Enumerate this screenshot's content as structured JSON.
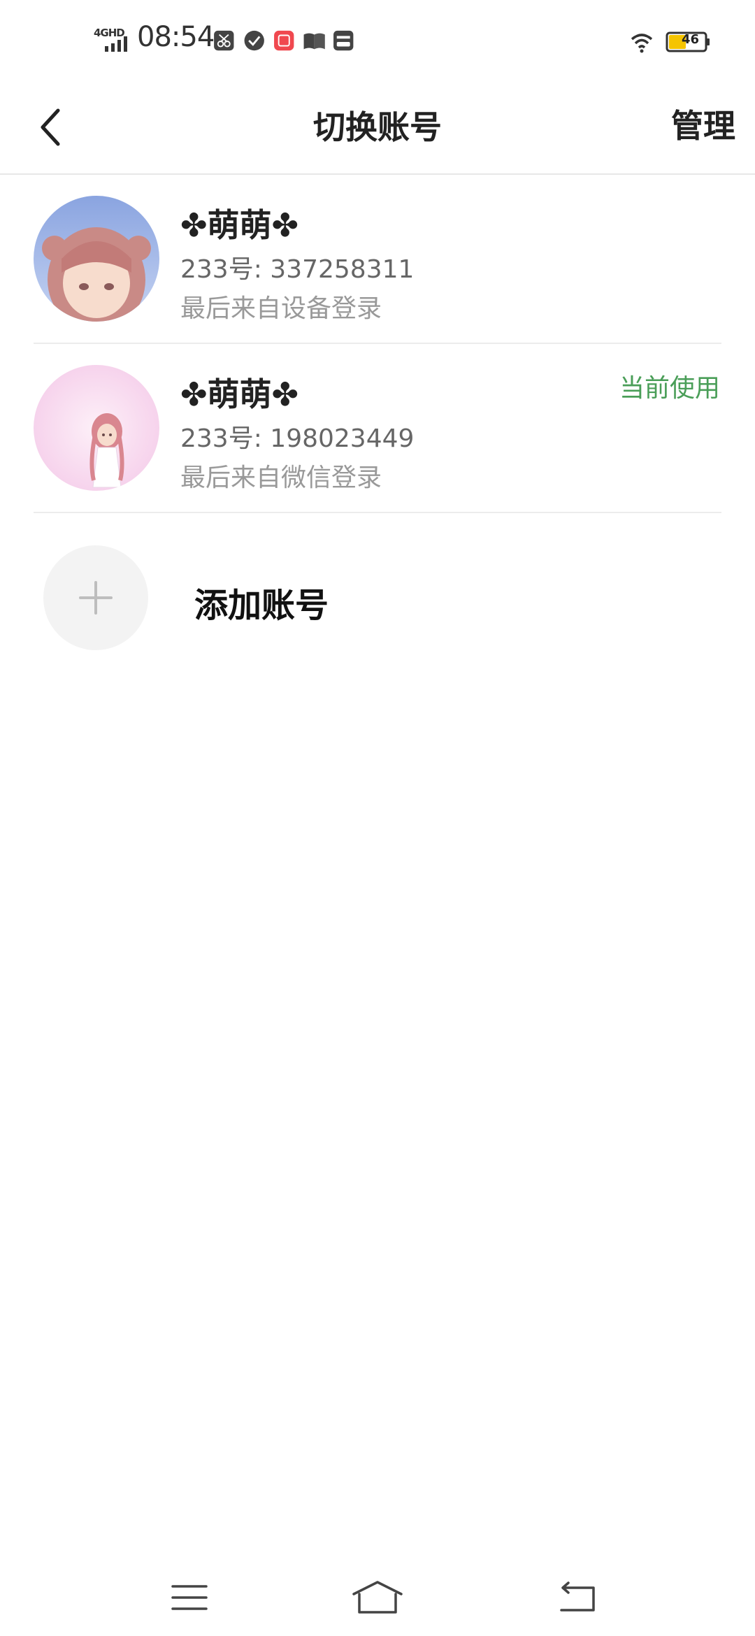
{
  "status_bar": {
    "network": "4GHD",
    "time": "08:54",
    "battery_level": "46",
    "icons": [
      "cut-icon",
      "check-circle-icon",
      "video-app-icon",
      "book-icon",
      "wallet-icon",
      "wifi-icon",
      "battery-icon"
    ]
  },
  "nav": {
    "title": "切换账号",
    "manage_label": "管理"
  },
  "accounts": [
    {
      "name": "✤萌萌✤",
      "id_text": "233号: 337258311",
      "login_text": "最后来自设备登录",
      "current": ""
    },
    {
      "name": "✤萌萌✤",
      "id_text": "233号: 198023449",
      "login_text": "最后来自微信登录",
      "current": "当前使用"
    }
  ],
  "add_account": {
    "label": "添加账号"
  },
  "colors": {
    "accent_green": "#4a9e58",
    "divider": "#ececec",
    "battery_fill": "#f5c400"
  }
}
